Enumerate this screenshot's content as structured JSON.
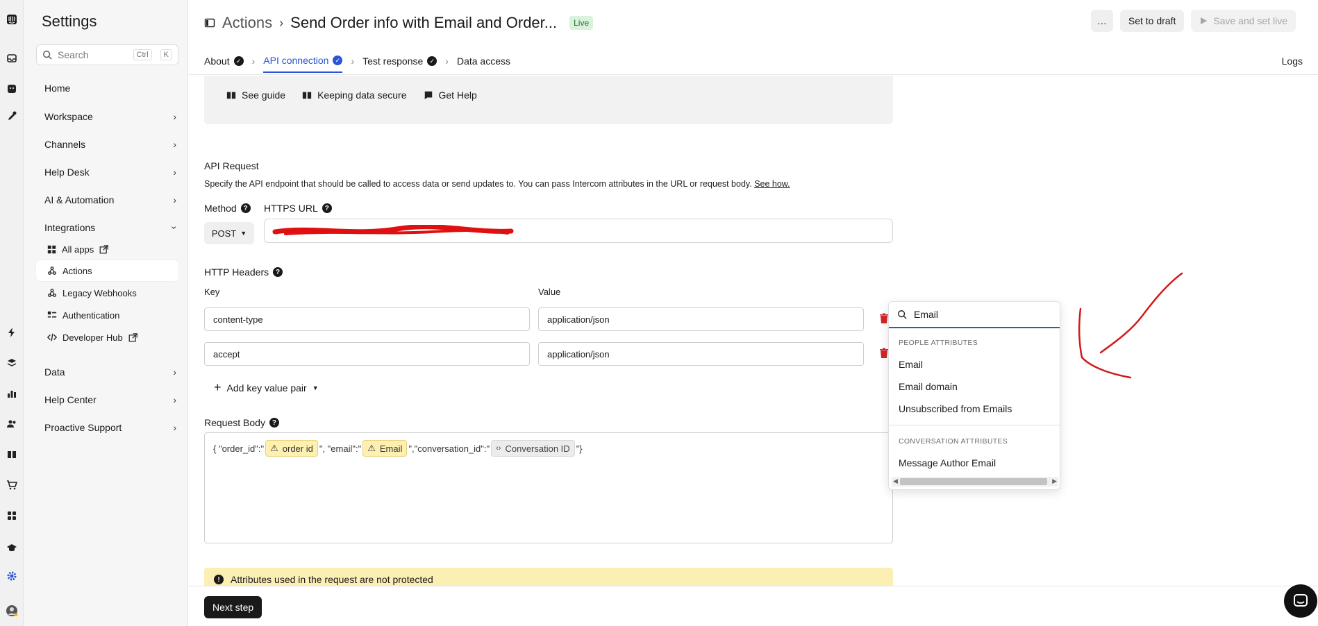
{
  "sidebar": {
    "title": "Settings",
    "search_placeholder": "Search",
    "shortcut_ctrl": "Ctrl",
    "shortcut_key": "K",
    "items": [
      {
        "label": "Home"
      },
      {
        "label": "Workspace"
      },
      {
        "label": "Channels"
      },
      {
        "label": "Help Desk"
      },
      {
        "label": "AI & Automation"
      },
      {
        "label": "Integrations"
      },
      {
        "label": "Data"
      },
      {
        "label": "Help Center"
      },
      {
        "label": "Proactive Support"
      }
    ],
    "integrations_sub": [
      {
        "label": "All apps"
      },
      {
        "label": "Actions"
      },
      {
        "label": "Legacy Webhooks"
      },
      {
        "label": "Authentication"
      },
      {
        "label": "Developer Hub"
      }
    ]
  },
  "header": {
    "breadcrumb_parent": "Actions",
    "title": "Send Order info with Email and Order...",
    "status_badge": "Live",
    "more_label": "…",
    "set_to_draft": "Set to draft",
    "save_and_set_live": "Save and set live",
    "logs": "Logs",
    "tabs": [
      {
        "label": "About"
      },
      {
        "label": "API connection"
      },
      {
        "label": "Test response"
      },
      {
        "label": "Data access"
      }
    ]
  },
  "guide": {
    "see_guide": "See guide",
    "keeping_data_secure": "Keeping data secure",
    "get_help": "Get Help"
  },
  "api_request": {
    "title": "API Request",
    "description": "Specify the API endpoint that should be called to access data or send updates to. You can pass Intercom attributes in the URL or request body.",
    "see_how": "See how.",
    "method_label": "Method",
    "url_label": "HTTPS URL",
    "method_value": "POST"
  },
  "headers": {
    "title": "HTTP Headers",
    "key_label": "Key",
    "value_label": "Value",
    "rows": [
      {
        "key": "content-type",
        "value": "application/json"
      },
      {
        "key": "accept",
        "value": "application/json"
      }
    ],
    "add_pair": "Add key value pair"
  },
  "body": {
    "title": "Request Body",
    "t1": "{ \"order_id\":\"",
    "chip1": "order id",
    "t2": "\", \"email\":\"",
    "chip2": "Email",
    "t3": "\",\"conversation_id\":\"",
    "chip3": "Conversation ID",
    "t4": "\"}"
  },
  "alert": "Attributes used in the request are not protected",
  "footer": {
    "next_step": "Next step"
  },
  "dropdown": {
    "query": "Email",
    "group1": "PEOPLE ATTRIBUTES",
    "group1_items": [
      "Email",
      "Email domain",
      "Unsubscribed from Emails"
    ],
    "group2": "CONVERSATION ATTRIBUTES",
    "group2_items": [
      "Message Author Email"
    ]
  },
  "colors": {
    "accent": "#2a55d6",
    "live_badge_bg": "#d9f2dc",
    "warning_bg": "#fcefb4",
    "trash": "#d0262b",
    "annotation": "#d11a1a"
  }
}
